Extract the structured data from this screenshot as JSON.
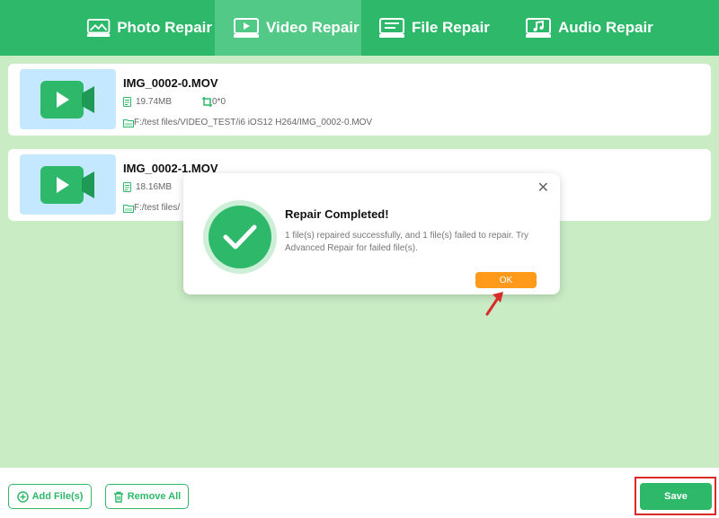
{
  "tabs": [
    {
      "label": "Photo Repair",
      "icon": "photo-repair-icon",
      "active": false
    },
    {
      "label": "Video Repair",
      "icon": "video-repair-icon",
      "active": true
    },
    {
      "label": "File Repair",
      "icon": "file-repair-icon",
      "active": false
    },
    {
      "label": "Audio Repair",
      "icon": "audio-repair-icon",
      "active": false
    }
  ],
  "files": [
    {
      "name": "IMG_0002-0.MOV",
      "size": "19.74MB",
      "resolution": "0*0",
      "path": "F:/test files/VIDEO_TEST/i6 iOS12 H264/IMG_0002-0.MOV"
    },
    {
      "name": "IMG_0002-1.MOV",
      "size": "18.16MB",
      "path": "F:/test files/"
    }
  ],
  "dialog": {
    "title": "Repair Completed!",
    "message": "1 file(s) repaired successfully, and 1 file(s) failed to repair. Try Advanced Repair for failed file(s).",
    "ok_label": "OK",
    "close_glyph": "✕"
  },
  "footer": {
    "add_label": "Add File(s)",
    "remove_label": "Remove All",
    "save_label": "Save"
  },
  "colors": {
    "accent": "#2db86a",
    "background": "#c9ecc4",
    "ok_button": "#ff9a1a",
    "highlight": "#d92a2a"
  }
}
